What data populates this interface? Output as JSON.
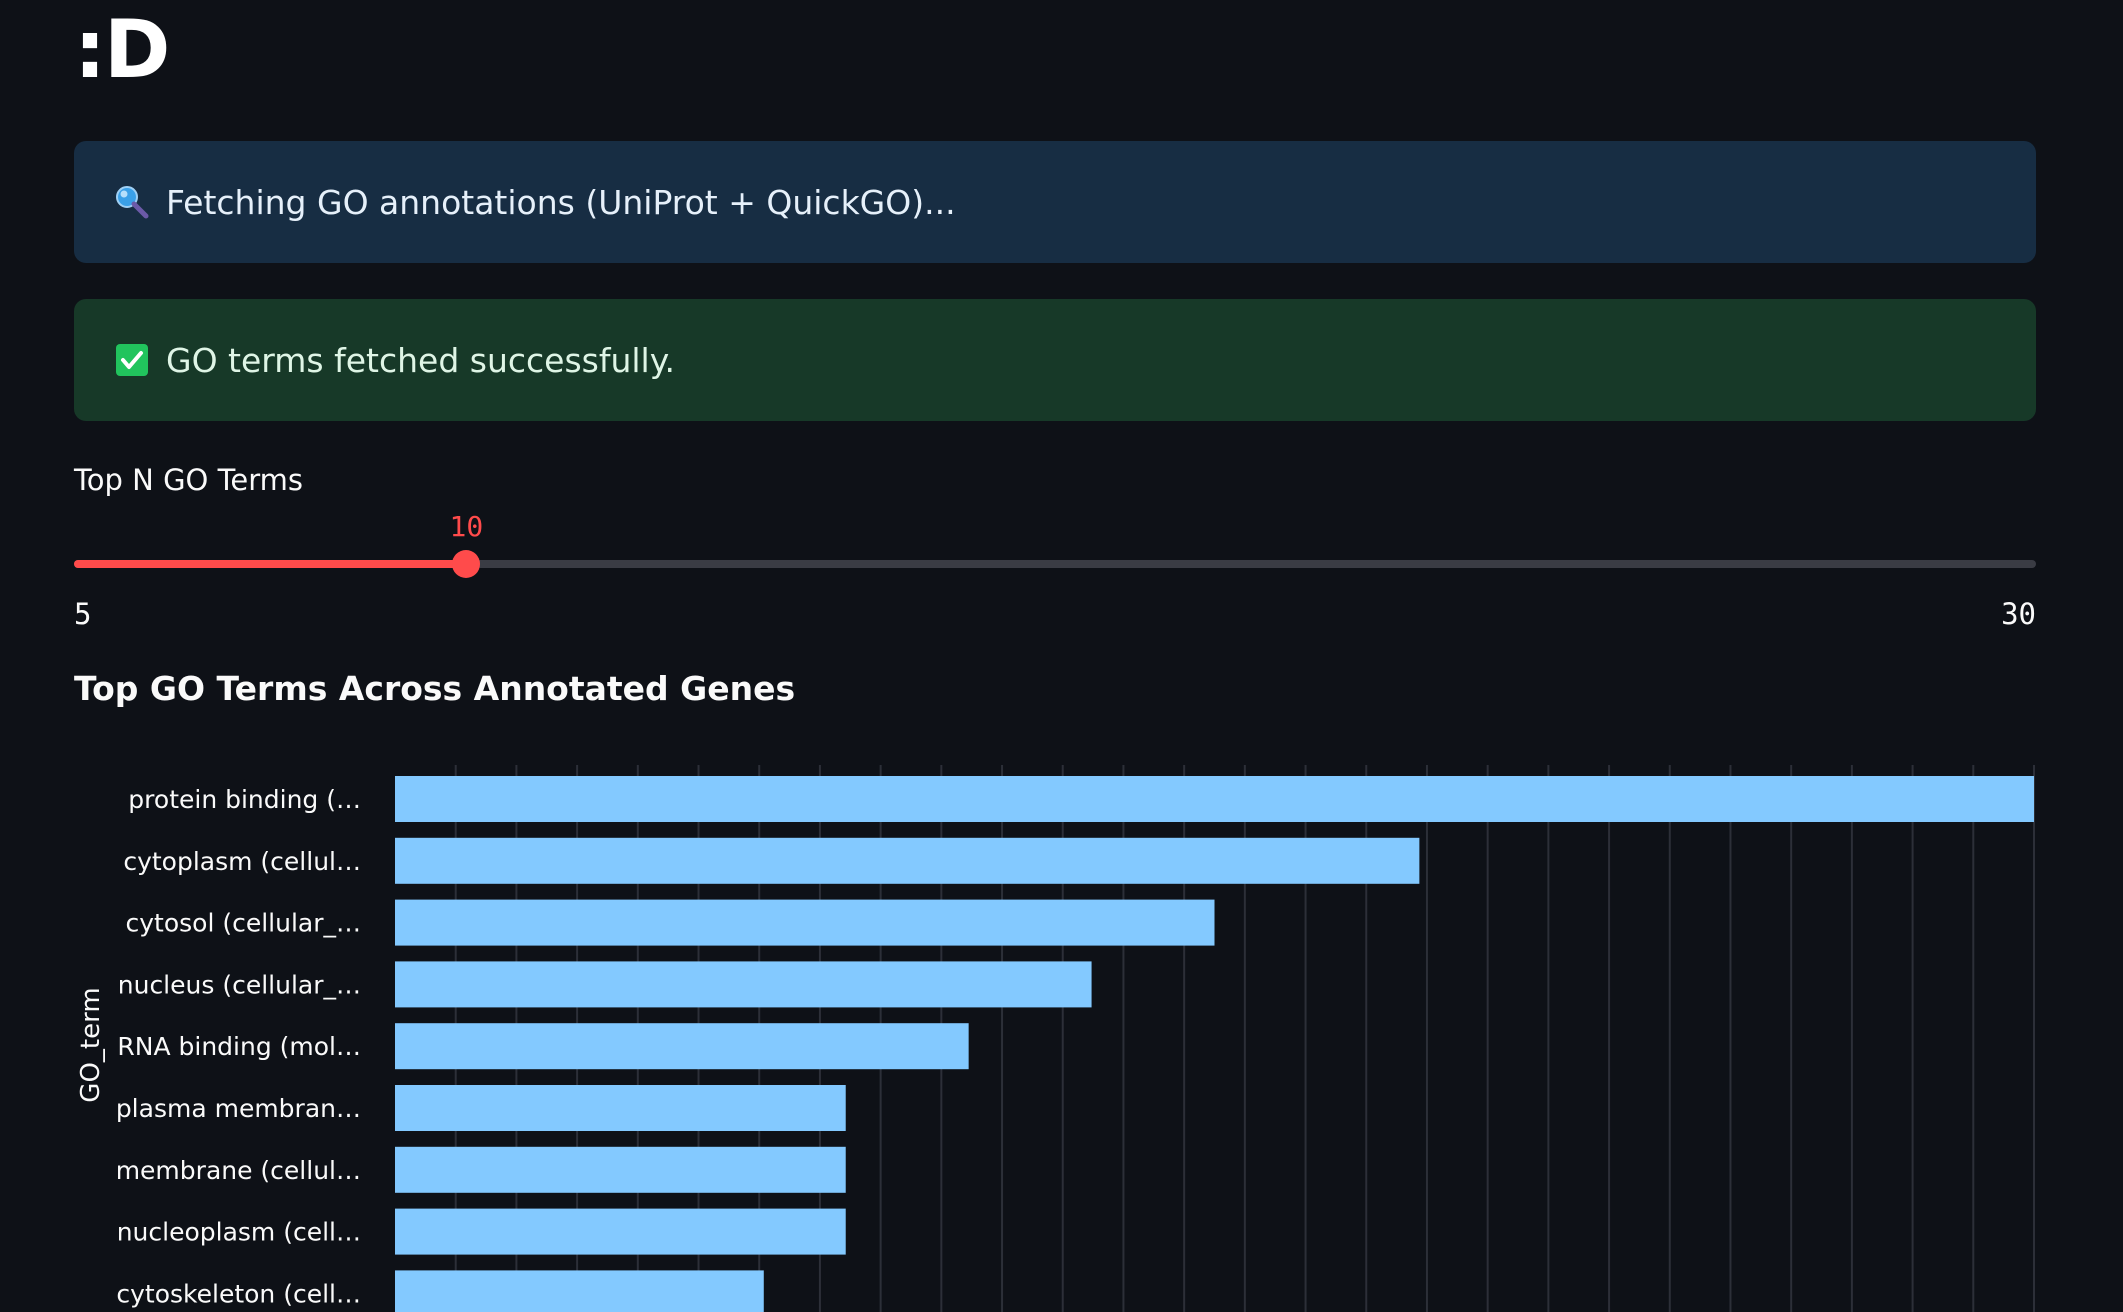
{
  "logo": {
    "text": ":D"
  },
  "info_alert": {
    "icon": "magnifier-icon",
    "message": "Fetching GO annotations (UniProt + QuickGO)..."
  },
  "success_alert": {
    "icon": "check-box-icon",
    "message": "GO terms fetched successfully."
  },
  "slider": {
    "label": "Top N GO Terms",
    "value": "10",
    "min": "5",
    "max": "30",
    "accent_color": "#ff4b4b"
  },
  "chart": {
    "title": "Top GO Terms Across Annotated Genes"
  },
  "chart_data": {
    "type": "bar",
    "orientation": "horizontal",
    "ylabel": "GO_term",
    "categories": [
      "protein binding (…",
      "cytoplasm (cellul…",
      "cytosol (cellular_…",
      "nucleus (cellular_…",
      "RNA binding (mol…",
      "plasma membran…",
      "membrane (cellul…",
      "nucleoplasm (cell…",
      "cytoskeleton (cell…"
    ],
    "values": [
      20,
      12.5,
      10,
      8.5,
      7,
      5.5,
      5.5,
      5.5,
      4.5
    ],
    "xlim": [
      0,
      20
    ],
    "grid": true,
    "bar_color": "#83c9ff"
  }
}
